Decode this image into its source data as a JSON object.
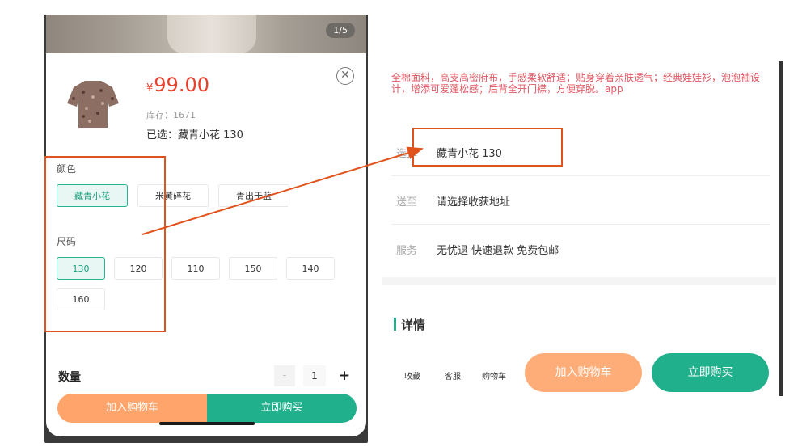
{
  "left": {
    "image_counter": "1/5",
    "price_symbol": "¥",
    "price": "99.00",
    "stock": "库存：1671",
    "selected": "已选：藏青小花 130",
    "color_label": "颜色",
    "colors": [
      "藏青小花",
      "米黄碎花",
      "青出于蓝"
    ],
    "size_label": "尺码",
    "sizes": [
      "130",
      "120",
      "110",
      "150",
      "140",
      "160"
    ],
    "qty_label": "数量",
    "qty_minus": "-",
    "qty_value": "1",
    "qty_plus": "+",
    "add_cart": "加入购物车",
    "buy_now": "立即购买"
  },
  "right": {
    "description": "全棉面料，高支高密府布，手感柔软舒适；贴身穿着亲肤透气；经典娃娃衫，泡泡袖设计，增添可爱蓬松感；后背全开门襟，方便穿脱。app",
    "rows": [
      {
        "label": "选择",
        "value": "藏青小花 130"
      },
      {
        "label": "送至",
        "value": "请选择收获地址"
      },
      {
        "label": "服务",
        "value": "无忧退 快速退款 免费包邮"
      }
    ],
    "detail_title": "详情",
    "icons": [
      "收藏",
      "客服",
      "购物车"
    ],
    "add_cart": "加入购物车",
    "buy_now": "立即购买"
  },
  "colors": {
    "accent": "#21b08c",
    "orange_button": "#ffa56b",
    "price_red": "#e8402b",
    "annotation": "#e0531c"
  }
}
